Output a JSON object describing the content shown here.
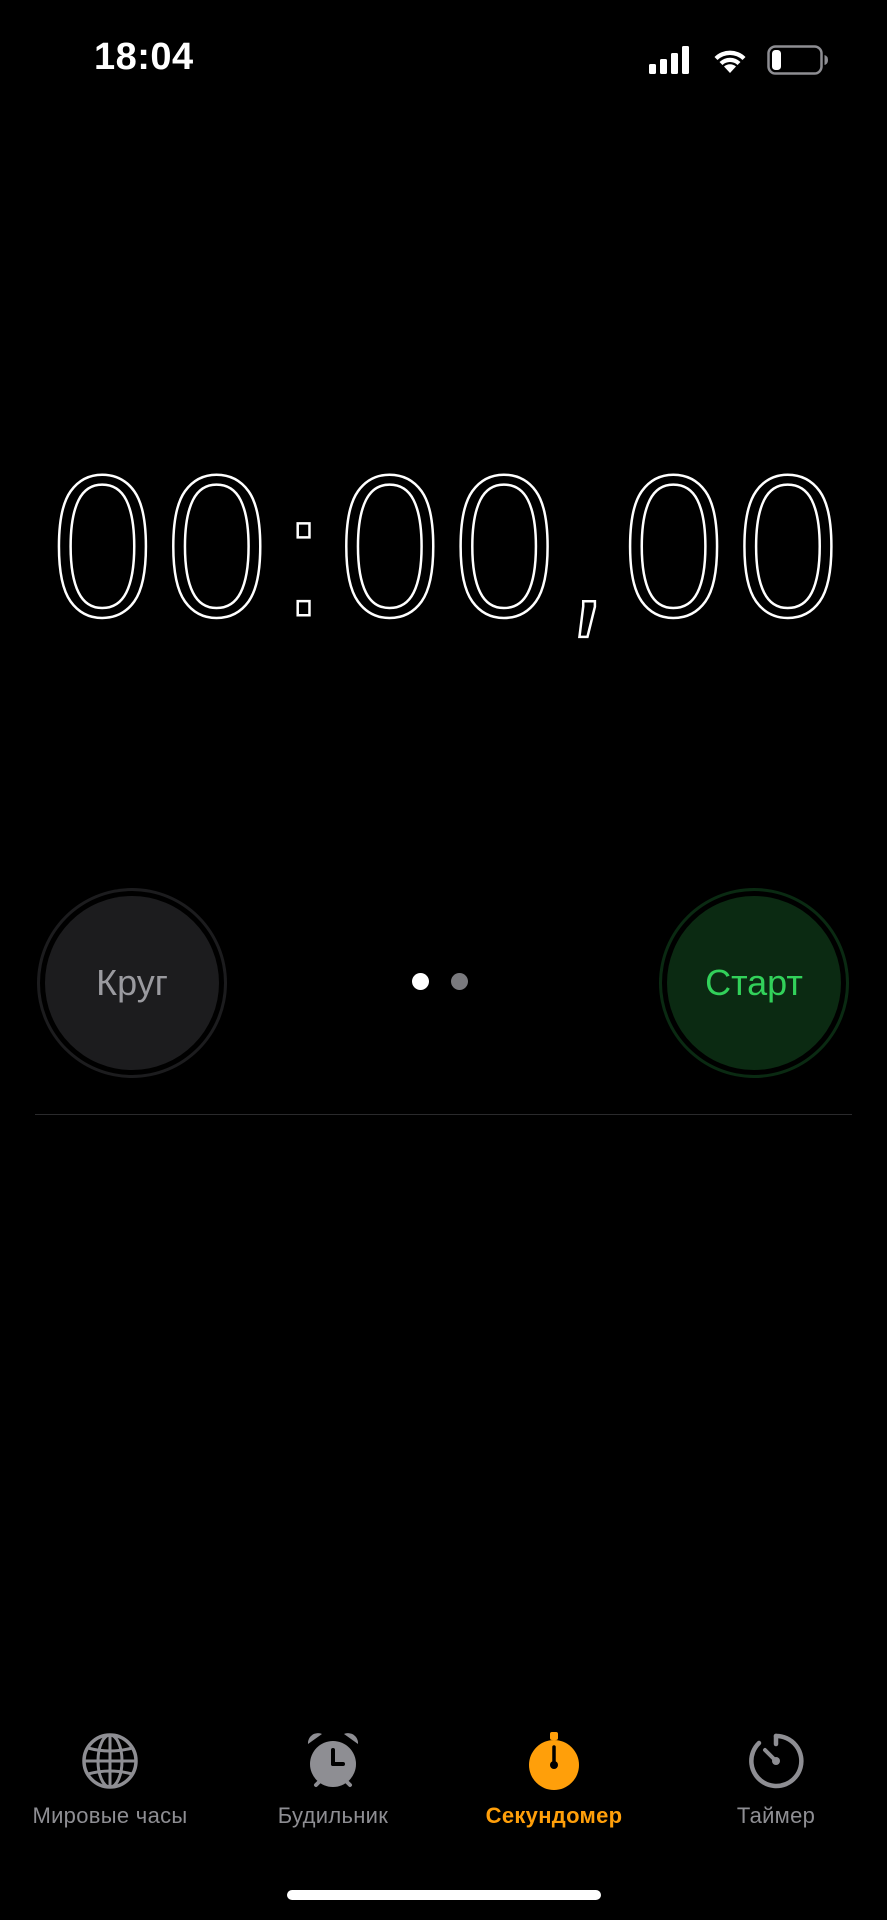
{
  "status_bar": {
    "time": "18:04",
    "icons": [
      "signal-icon",
      "wifi-icon",
      "battery-icon"
    ],
    "battery_level": 0.2
  },
  "stopwatch": {
    "display": "00:00,00"
  },
  "controls": {
    "lap_label": "Круг",
    "start_label": "Старт",
    "page_count": 2,
    "active_page": 0
  },
  "tabs": [
    {
      "label": "Мировые часы",
      "icon": "globe-icon",
      "active": false
    },
    {
      "label": "Будильник",
      "icon": "alarm-clock-icon",
      "active": false
    },
    {
      "label": "Секундомер",
      "icon": "stopwatch-icon",
      "active": true
    },
    {
      "label": "Таймер",
      "icon": "timer-icon",
      "active": false
    }
  ],
  "colors": {
    "background": "#000000",
    "accent": "#ff9f0a",
    "start_text": "#32d15a",
    "start_bg": "#0b2a12",
    "lap_text": "#9a9a9f",
    "lap_bg": "#1c1c1e",
    "inactive_tab": "#8e8e93"
  }
}
